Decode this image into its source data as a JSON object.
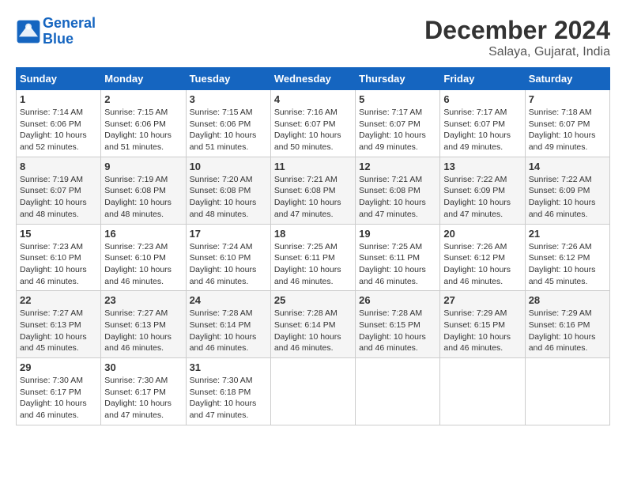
{
  "header": {
    "logo_line1": "General",
    "logo_line2": "Blue",
    "month_year": "December 2024",
    "location": "Salaya, Gujarat, India"
  },
  "weekdays": [
    "Sunday",
    "Monday",
    "Tuesday",
    "Wednesday",
    "Thursday",
    "Friday",
    "Saturday"
  ],
  "weeks": [
    [
      {
        "day": "1",
        "info": "Sunrise: 7:14 AM\nSunset: 6:06 PM\nDaylight: 10 hours\nand 52 minutes."
      },
      {
        "day": "2",
        "info": "Sunrise: 7:15 AM\nSunset: 6:06 PM\nDaylight: 10 hours\nand 51 minutes."
      },
      {
        "day": "3",
        "info": "Sunrise: 7:15 AM\nSunset: 6:06 PM\nDaylight: 10 hours\nand 51 minutes."
      },
      {
        "day": "4",
        "info": "Sunrise: 7:16 AM\nSunset: 6:07 PM\nDaylight: 10 hours\nand 50 minutes."
      },
      {
        "day": "5",
        "info": "Sunrise: 7:17 AM\nSunset: 6:07 PM\nDaylight: 10 hours\nand 49 minutes."
      },
      {
        "day": "6",
        "info": "Sunrise: 7:17 AM\nSunset: 6:07 PM\nDaylight: 10 hours\nand 49 minutes."
      },
      {
        "day": "7",
        "info": "Sunrise: 7:18 AM\nSunset: 6:07 PM\nDaylight: 10 hours\nand 49 minutes."
      }
    ],
    [
      {
        "day": "8",
        "info": "Sunrise: 7:19 AM\nSunset: 6:07 PM\nDaylight: 10 hours\nand 48 minutes."
      },
      {
        "day": "9",
        "info": "Sunrise: 7:19 AM\nSunset: 6:08 PM\nDaylight: 10 hours\nand 48 minutes."
      },
      {
        "day": "10",
        "info": "Sunrise: 7:20 AM\nSunset: 6:08 PM\nDaylight: 10 hours\nand 48 minutes."
      },
      {
        "day": "11",
        "info": "Sunrise: 7:21 AM\nSunset: 6:08 PM\nDaylight: 10 hours\nand 47 minutes."
      },
      {
        "day": "12",
        "info": "Sunrise: 7:21 AM\nSunset: 6:08 PM\nDaylight: 10 hours\nand 47 minutes."
      },
      {
        "day": "13",
        "info": "Sunrise: 7:22 AM\nSunset: 6:09 PM\nDaylight: 10 hours\nand 47 minutes."
      },
      {
        "day": "14",
        "info": "Sunrise: 7:22 AM\nSunset: 6:09 PM\nDaylight: 10 hours\nand 46 minutes."
      }
    ],
    [
      {
        "day": "15",
        "info": "Sunrise: 7:23 AM\nSunset: 6:10 PM\nDaylight: 10 hours\nand 46 minutes."
      },
      {
        "day": "16",
        "info": "Sunrise: 7:23 AM\nSunset: 6:10 PM\nDaylight: 10 hours\nand 46 minutes."
      },
      {
        "day": "17",
        "info": "Sunrise: 7:24 AM\nSunset: 6:10 PM\nDaylight: 10 hours\nand 46 minutes."
      },
      {
        "day": "18",
        "info": "Sunrise: 7:25 AM\nSunset: 6:11 PM\nDaylight: 10 hours\nand 46 minutes."
      },
      {
        "day": "19",
        "info": "Sunrise: 7:25 AM\nSunset: 6:11 PM\nDaylight: 10 hours\nand 46 minutes."
      },
      {
        "day": "20",
        "info": "Sunrise: 7:26 AM\nSunset: 6:12 PM\nDaylight: 10 hours\nand 46 minutes."
      },
      {
        "day": "21",
        "info": "Sunrise: 7:26 AM\nSunset: 6:12 PM\nDaylight: 10 hours\nand 45 minutes."
      }
    ],
    [
      {
        "day": "22",
        "info": "Sunrise: 7:27 AM\nSunset: 6:13 PM\nDaylight: 10 hours\nand 45 minutes."
      },
      {
        "day": "23",
        "info": "Sunrise: 7:27 AM\nSunset: 6:13 PM\nDaylight: 10 hours\nand 46 minutes."
      },
      {
        "day": "24",
        "info": "Sunrise: 7:28 AM\nSunset: 6:14 PM\nDaylight: 10 hours\nand 46 minutes."
      },
      {
        "day": "25",
        "info": "Sunrise: 7:28 AM\nSunset: 6:14 PM\nDaylight: 10 hours\nand 46 minutes."
      },
      {
        "day": "26",
        "info": "Sunrise: 7:28 AM\nSunset: 6:15 PM\nDaylight: 10 hours\nand 46 minutes."
      },
      {
        "day": "27",
        "info": "Sunrise: 7:29 AM\nSunset: 6:15 PM\nDaylight: 10 hours\nand 46 minutes."
      },
      {
        "day": "28",
        "info": "Sunrise: 7:29 AM\nSunset: 6:16 PM\nDaylight: 10 hours\nand 46 minutes."
      }
    ],
    [
      {
        "day": "29",
        "info": "Sunrise: 7:30 AM\nSunset: 6:17 PM\nDaylight: 10 hours\nand 46 minutes."
      },
      {
        "day": "30",
        "info": "Sunrise: 7:30 AM\nSunset: 6:17 PM\nDaylight: 10 hours\nand 47 minutes."
      },
      {
        "day": "31",
        "info": "Sunrise: 7:30 AM\nSunset: 6:18 PM\nDaylight: 10 hours\nand 47 minutes."
      },
      {
        "day": "",
        "info": ""
      },
      {
        "day": "",
        "info": ""
      },
      {
        "day": "",
        "info": ""
      },
      {
        "day": "",
        "info": ""
      }
    ]
  ]
}
